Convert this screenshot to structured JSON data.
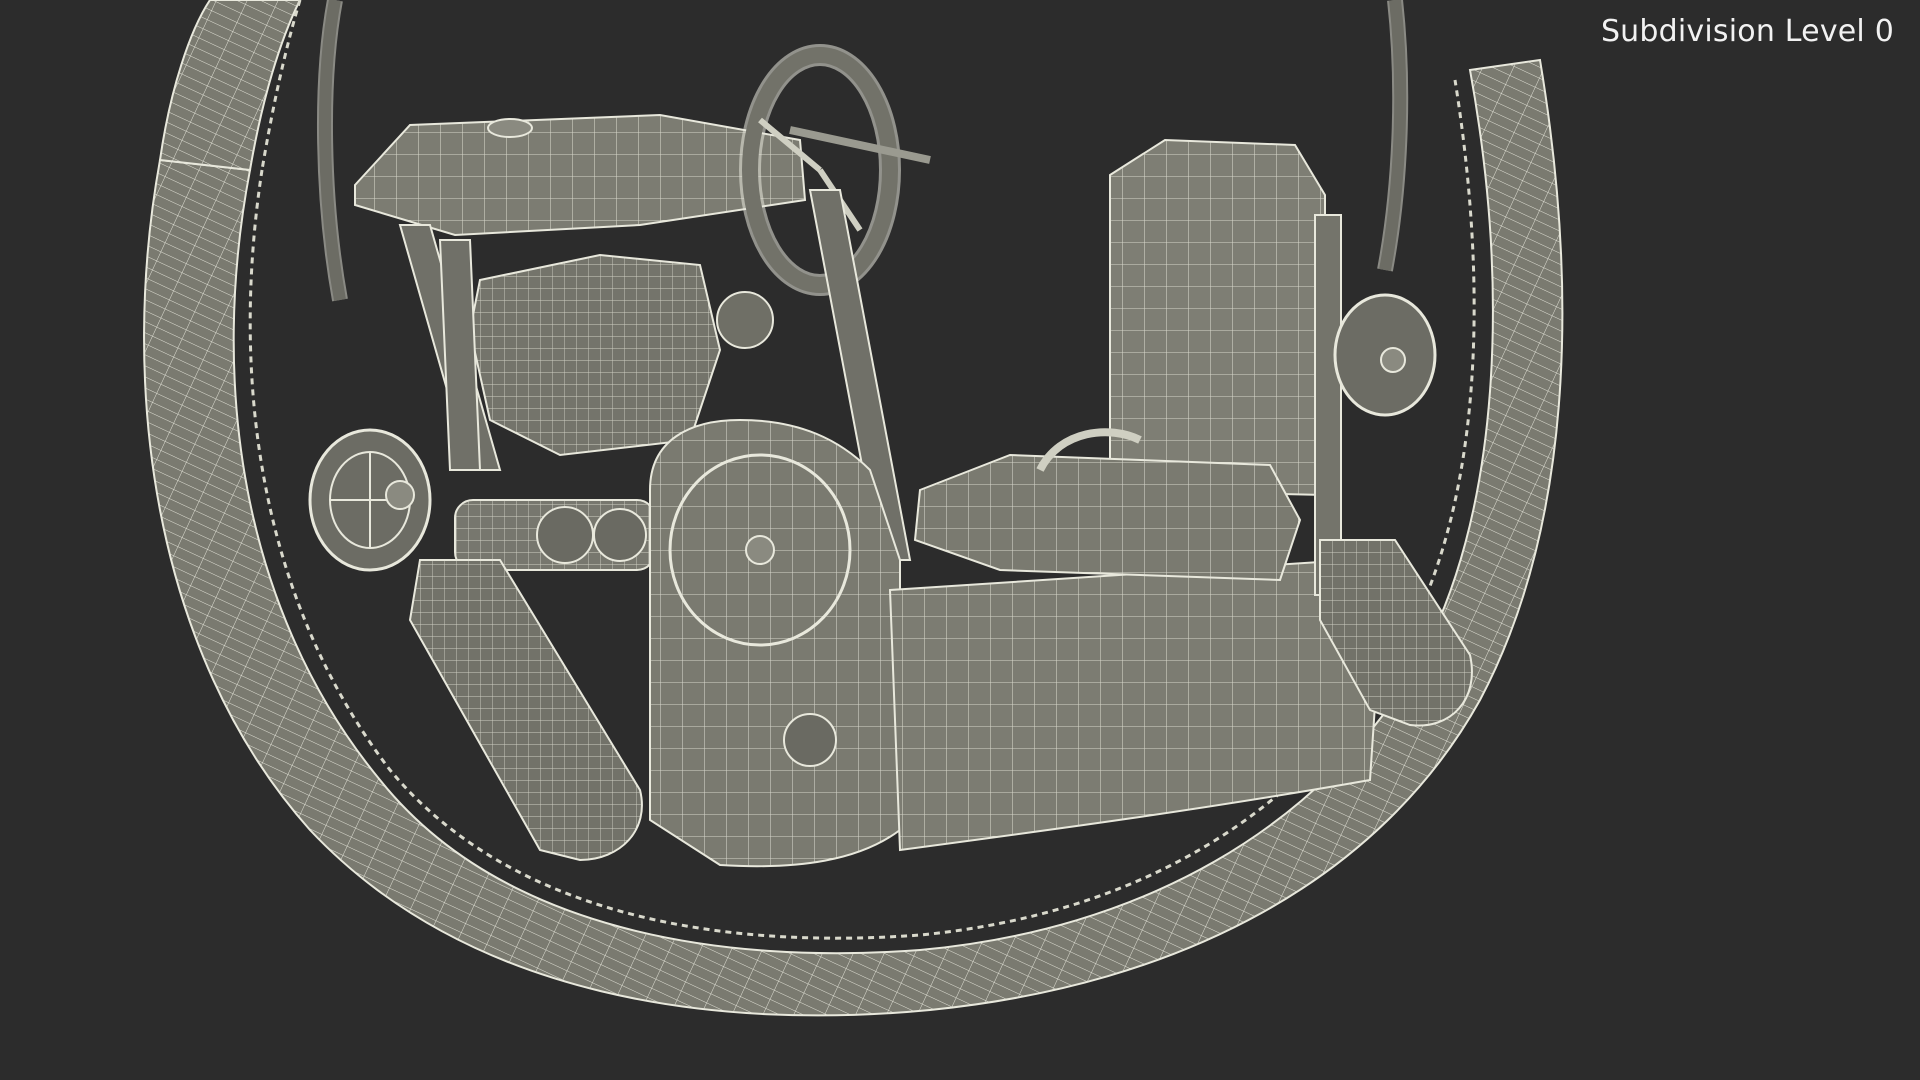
{
  "overlay": {
    "subdivision_label": "Subdivision Level 0"
  },
  "colors": {
    "background": "#2c2c2c",
    "mesh_fill": "#7a7a70",
    "mesh_fill_dark": "#5e5e56",
    "wire": "#e8e8dc",
    "wire_dim": "#cfcfc2",
    "label_text": "#f2f2f2"
  },
  "scene": {
    "subject": "wireframe 3d model render",
    "icon": "wireframe-mesh-icon"
  }
}
